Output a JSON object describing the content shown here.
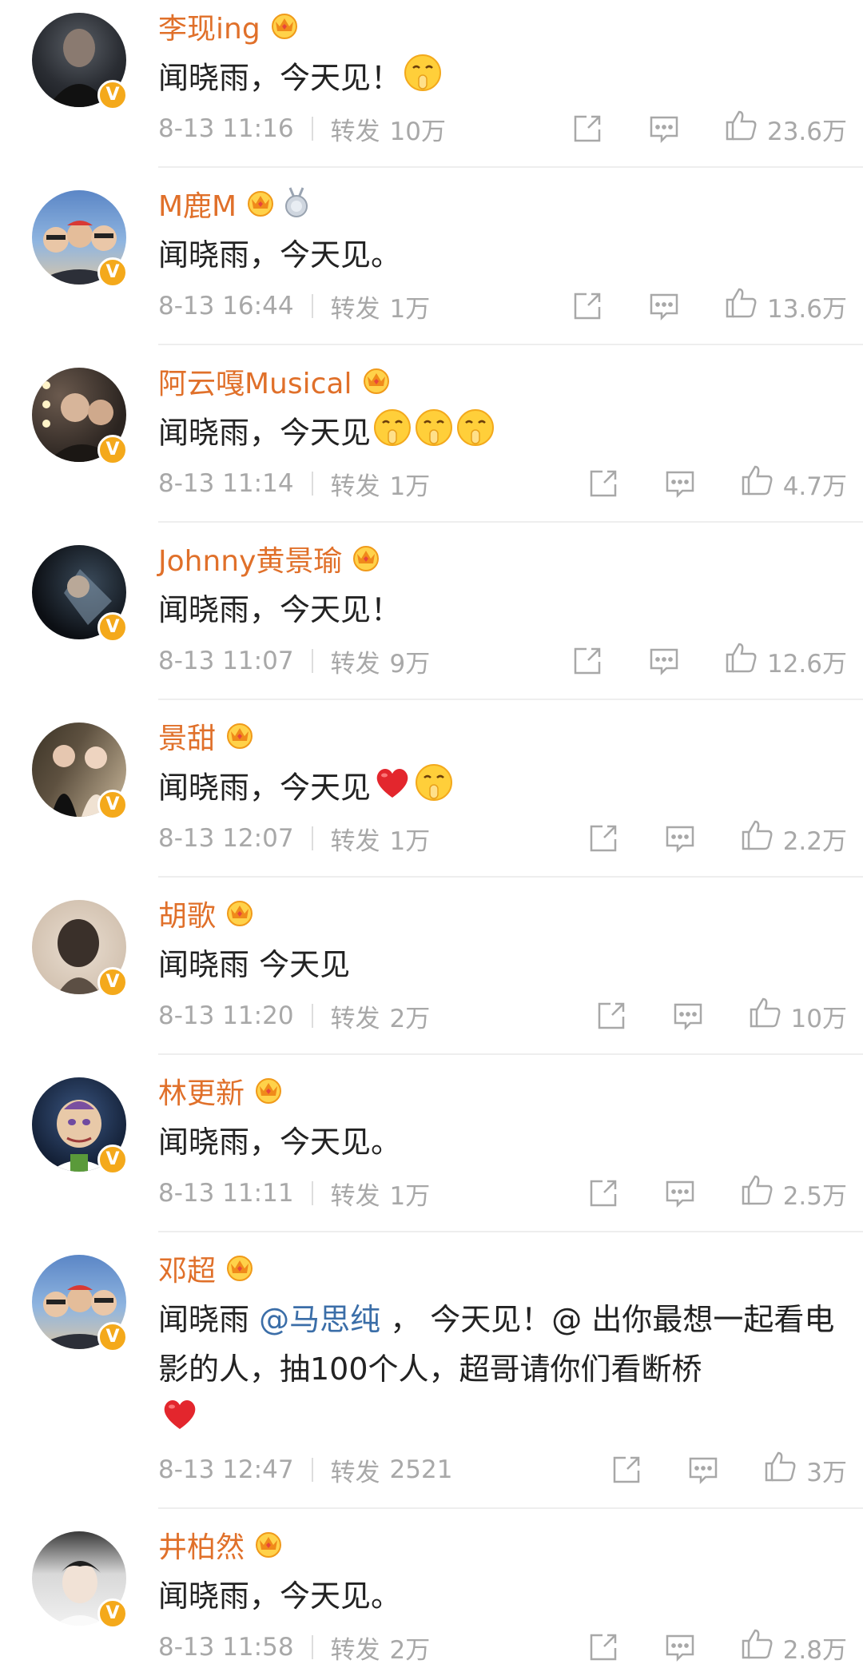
{
  "colors": {
    "username": "#e0702a",
    "text": "#222222",
    "meta": "#a8a8a8",
    "mention": "#3b6ea8",
    "vip_badge": "#f4a91b"
  },
  "comments": [
    {
      "username": "李现ing",
      "content": "闻晓雨，今天见！",
      "emojis": [
        "shush-face-emoji"
      ],
      "time": "8-13 11:16",
      "repost_label": "转发",
      "reposts": "10万",
      "likes": "23.6万"
    },
    {
      "username": "M鹿M",
      "content": "闻晓雨，今天见。",
      "emojis": [],
      "time": "8-13 16:44",
      "repost_label": "转发",
      "reposts": "1万",
      "likes": "13.6万"
    },
    {
      "username": "阿云嘎Musical",
      "content": "闻晓雨，今天见",
      "emojis": [
        "shush-face-emoji",
        "shush-face-emoji",
        "shush-face-emoji"
      ],
      "time": "8-13 11:14",
      "repost_label": "转发",
      "reposts": "1万",
      "likes": "4.7万"
    },
    {
      "username": "Johnny黄景瑜",
      "content": "闻晓雨，今天见！",
      "emojis": [],
      "time": "8-13 11:07",
      "repost_label": "转发",
      "reposts": "9万",
      "likes": "12.6万"
    },
    {
      "username": "景甜",
      "content": "闻晓雨，今天见",
      "emojis": [
        "red-heart-emoji",
        "shush-face-emoji"
      ],
      "time": "8-13 12:07",
      "repost_label": "转发",
      "reposts": "1万",
      "likes": "2.2万"
    },
    {
      "username": "胡歌",
      "content": "闻晓雨 今天见",
      "emojis": [],
      "time": "8-13 11:20",
      "repost_label": "转发",
      "reposts": "2万",
      "likes": "10万"
    },
    {
      "username": "林更新",
      "content": "闻晓雨，今天见。",
      "emojis": [],
      "time": "8-13 11:11",
      "repost_label": "转发",
      "reposts": "1万",
      "likes": "2.5万"
    },
    {
      "username": "邓超",
      "content_pre": "闻晓雨 ",
      "mention": "@马思纯",
      "content_post": " ， 今天见！@ 出你最想一起看电影的人，抽100个人，超哥请你们看断桥",
      "emojis": [
        "red-heart-emoji"
      ],
      "time": "8-13 12:47",
      "repost_label": "转发",
      "reposts": "2521",
      "likes": "3万"
    },
    {
      "username": "井柏然",
      "content": "闻晓雨，今天见。",
      "emojis": [],
      "time": "8-13 11:58",
      "repost_label": "转发",
      "reposts": "2万",
      "likes": "2.8万"
    }
  ]
}
